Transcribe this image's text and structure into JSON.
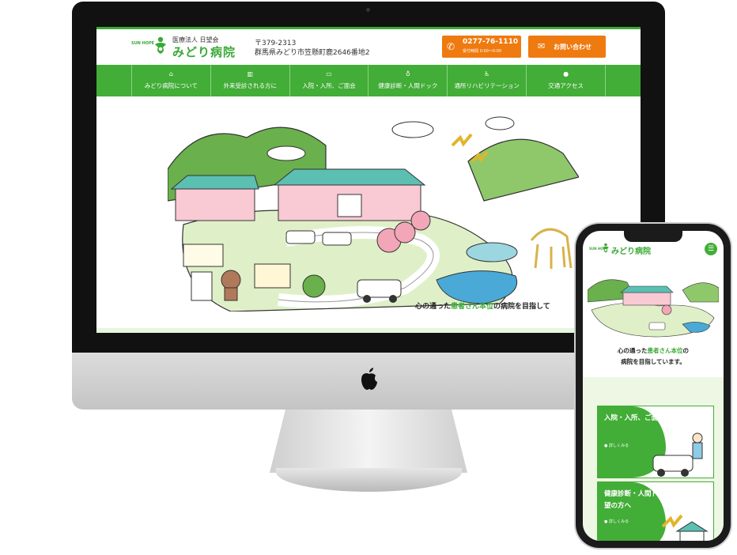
{
  "desktop": {
    "logo": {
      "sun": "SUN HOPE",
      "sub": "医療法人 日望会",
      "main": "みどり病院"
    },
    "address": {
      "zip": "〒379-2313",
      "line": "群馬県みどり市笠懸町鹿2646番地2"
    },
    "tel": {
      "number": "0277-76-1110",
      "hours": "受付時間 0:00～0:00",
      "icon": "phone-icon"
    },
    "contact": {
      "label": "お問い合わせ",
      "icon": "mail-icon"
    },
    "nav": [
      {
        "label": "みどり病院について",
        "icon": "home-icon"
      },
      {
        "label": "外来受診される方に",
        "icon": "clinic-icon"
      },
      {
        "label": "入院・入所、ご面会",
        "icon": "bed-icon"
      },
      {
        "label": "健康診断・人間ドック",
        "icon": "stethoscope-icon"
      },
      {
        "label": "通所リハビリテーション",
        "icon": "wheelchair-icon"
      },
      {
        "label": "交通アクセス",
        "icon": "map-pin-icon"
      }
    ],
    "catch": {
      "pre": "心の通った",
      "highlight": "患者さん本位",
      "post": "の病院を目指して"
    }
  },
  "mobile": {
    "logo": {
      "sun": "SUN HOPE",
      "main": "みどり病院"
    },
    "menu_icon": "menu-icon",
    "catch": {
      "line1_pre": "心の通った",
      "highlight": "患者さん本位",
      "line1_post": "の",
      "line2": "病院を目指しています。"
    },
    "cards": [
      {
        "title": "入院・入所、ご面会の方へ",
        "more": "詳しくみる"
      },
      {
        "title": "健康診断・人間ドックをご希望の方へ",
        "more": "詳しくみる"
      }
    ]
  },
  "colors": {
    "brand_green": "#42ad37",
    "accent_orange": "#ef7a0f"
  }
}
